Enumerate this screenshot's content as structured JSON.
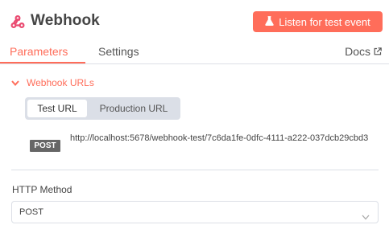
{
  "header": {
    "title": "Webhook",
    "listen_label": "Listen for test event",
    "icons": {
      "node": "webhook-icon",
      "listen": "flask-icon"
    }
  },
  "tabs": {
    "parameters": "Parameters",
    "settings": "Settings",
    "active": "Parameters",
    "docs": "Docs",
    "docs_icon": "external-link-icon"
  },
  "webhook_urls": {
    "title": "Webhook URLs",
    "expanded": true,
    "toggle": {
      "test": "Test URL",
      "production": "Production URL",
      "selected": "Test URL"
    },
    "method": "POST",
    "url": "http://localhost:5678/webhook-test/7c6da1fe-0dfc-4111-a222-037dcb29cbd3"
  },
  "http_method": {
    "label": "HTTP Method",
    "value": "POST"
  },
  "colors": {
    "accent": "#ff6d5a",
    "text": "#555555",
    "badge": "#666666",
    "toggle_bg": "#dbdfe7"
  }
}
